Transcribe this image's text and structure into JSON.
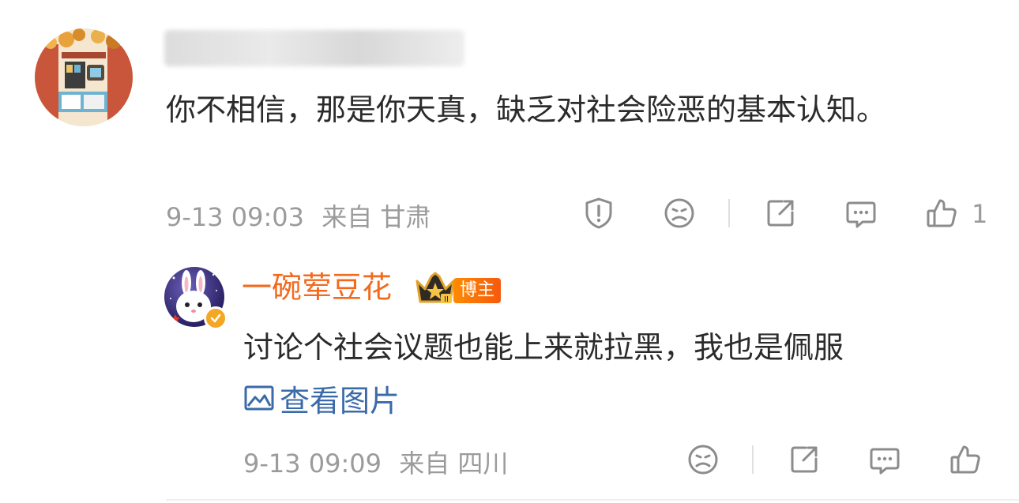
{
  "comment": {
    "text": "你不相信，那是你天真，缺乏对社会险恶的基本认知。",
    "time": "9-13 09:03",
    "source": "来自 甘肃",
    "like_count": "1",
    "actions": [
      "report-icon",
      "dislike-icon",
      "share-icon",
      "comment-icon",
      "like-icon"
    ]
  },
  "reply": {
    "username": "一碗荤豆花",
    "badge": "博主",
    "crown_level": "II",
    "text": "讨论个社会议题也能上来就拉黑，我也是佩服",
    "view_image_label": "查看图片",
    "time": "9-13 09:09",
    "source": "来自 四川",
    "actions": [
      "dislike-icon",
      "share-icon",
      "comment-icon",
      "like-icon"
    ]
  },
  "colors": {
    "username_accent": "#f36a1f",
    "link": "#3b6aa8",
    "meta": "#9b9b9b",
    "body_text": "#2b2b2b"
  }
}
